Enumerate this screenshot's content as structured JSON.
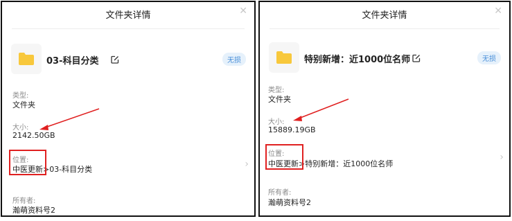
{
  "panels": [
    {
      "title": "文件夹详情",
      "close_icon": "close-icon",
      "folder_name": "03-科目分类",
      "badge": "无损",
      "type_label": "类型:",
      "type_value": "文件夹",
      "size_label": "大小:",
      "size_value": "2142.50GB",
      "location_label": "位置:",
      "location_root": "中医更新",
      "location_rest": ">03-科目分类",
      "owner_label": "所有者:",
      "owner_value": "瀚萌资料号2"
    },
    {
      "title": "文件夹详情",
      "close_icon": "close-icon",
      "folder_name": "特别新增：近1000位名师",
      "badge": "无损",
      "type_label": "类型:",
      "type_value": "文件夹",
      "size_label": "大小:",
      "size_value": "15889.19GB",
      "location_label": "位置:",
      "location_root": "中医更新",
      "location_rest": ">特别新增：近1000位名师",
      "owner_label": "所有者:",
      "owner_value": "瀚萌资料号2"
    }
  ],
  "colors": {
    "folder": "#f8c83c",
    "badge_text": "#4a90d9",
    "badge_bg": "#e6f1fb",
    "annotation": "#e02020"
  },
  "icons": [
    "folder-icon",
    "edit-icon",
    "close-icon",
    "chevron-right-icon"
  ]
}
